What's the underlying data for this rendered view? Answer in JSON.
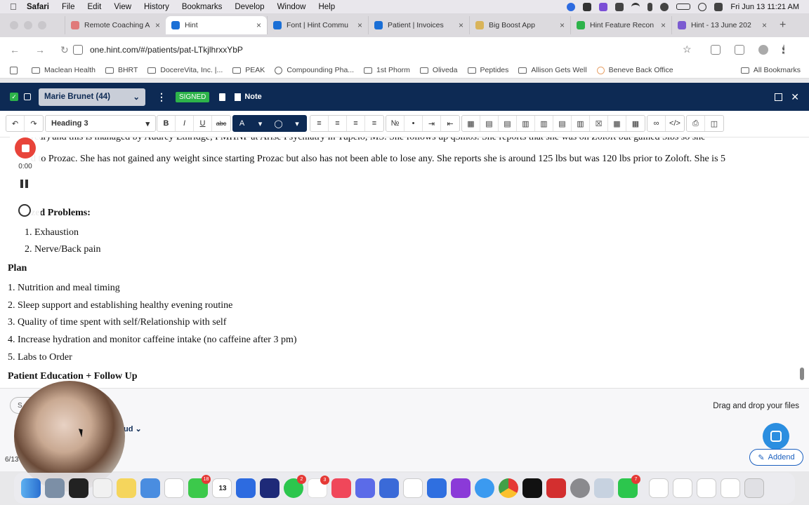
{
  "menubar": {
    "items": [
      "Safari",
      "File",
      "Edit",
      "View",
      "History",
      "Bookmarks",
      "Develop",
      "Window",
      "Help"
    ],
    "clock": "Fri Jun 13  11:21 AM"
  },
  "tabs": [
    {
      "label": "Remote Coaching A",
      "color": "#e07a7a"
    },
    {
      "label": "Hint",
      "color": "#1a6fd6"
    },
    {
      "label": "Font | Hint Commu",
      "color": "#1a6fd6"
    },
    {
      "label": "Patient | Invoices",
      "color": "#1a6fd6"
    },
    {
      "label": "Big Boost App",
      "color": "#d9b45a"
    },
    {
      "label": "Hint Feature Recon",
      "color": "#2db34a"
    },
    {
      "label": "Hint - 13 June 202",
      "color": "#7b5bd1"
    }
  ],
  "url": "one.hint.com/#/patients/pat-LTkjlhrxxYbP",
  "bookmarks": [
    "Maclean Health",
    "BHRT",
    "DocereVita, Inc. |...",
    "PEAK",
    "Compounding Pha...",
    "1st Phorm",
    "Oliveda",
    "Peptides",
    "Allison Gets Well",
    "Beneve Back Office"
  ],
  "all_bookmarks": "All Bookmarks",
  "header": {
    "patient": "Marie Brunet (44)",
    "signed": "SIGNED",
    "note": "Note"
  },
  "toolbar": {
    "heading": "Heading 3",
    "bold": "B",
    "italic": "I",
    "underline": "U",
    "strike": "abc",
    "font_color": "A"
  },
  "editor": {
    "line1": "a/year) and this is managed by Audrey Ethridge, PMHNP at Arise Psychiatry in Tupelo, MS. She follows up q3mos. She reports that she was on Zoloft but gained 5lbs so she",
    "line2": "d to Prozac. She has not gained any weight since starting Prozac but also has not been able to lose any. She reports she is around 125 lbs but was 120 lbs prior to Zoloft. She is 5",
    "prioritized": "zed Problems:",
    "problems": [
      "1. Exhaustion",
      "2. Nerve/Back pain"
    ],
    "plan_title": "Plan",
    "plan_items": [
      "1. Nutrition and meal timing",
      "2. Sleep support and establishing healthy evening routine",
      "3. Quality of time spent with self/Relationship with self",
      "4. Increase hydration and monitor caffeine intake (no caffeine after 3 pm)",
      "5. Labs to Order"
    ],
    "education": "Patient Education + Follow Up"
  },
  "recorder": {
    "time": "0:00"
  },
  "bottom": {
    "search": "S",
    "drag": "Drag and drop your files",
    "partial": "ud",
    "date": "6/13",
    "addend": "Addend"
  },
  "dock": {
    "calendar_day": "13",
    "apps": [
      "finder",
      "launchpad",
      "safari",
      "notes",
      "freeform",
      "reminders",
      "messages",
      "calendar",
      "zoom",
      "screenflow",
      "whatsapp",
      "slack",
      "music",
      "perplexity",
      "pen",
      "hemingway",
      "docs",
      "podcasts",
      "safari-alt",
      "chrome",
      "appletv",
      "acrobat",
      "settings",
      "preview",
      "facetime"
    ],
    "badges": {
      "messages": "18",
      "whatsapp": "2",
      "slack": "3",
      "facetime": "7"
    }
  }
}
